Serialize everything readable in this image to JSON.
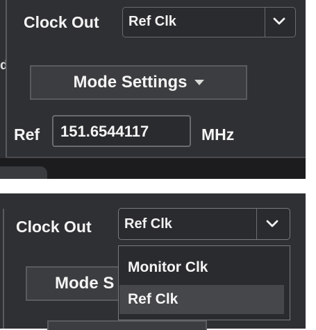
{
  "panel_top": {
    "fragment": "d",
    "clock_out": {
      "label": "Clock Out",
      "selected": "Ref Clk",
      "arrow_icon": "chevron-down-icon"
    },
    "mode_settings": {
      "label": "Mode Settings",
      "arrow_icon": "triangle-down-icon"
    },
    "ref": {
      "label": "Ref",
      "value": "151.6544117",
      "unit": "MHz"
    }
  },
  "panel_bottom": {
    "clock_out": {
      "label": "Clock Out",
      "selected": "Ref Clk",
      "arrow_icon": "chevron-down-icon"
    },
    "mode_button_label": "Mode S",
    "dropdown": {
      "options": [
        "Monitor Clk",
        "Ref Clk"
      ],
      "selected_index": 1
    }
  },
  "colors": {
    "panel_bg": "#2f3033",
    "border": "#6b6c70",
    "text": "#f5f5f5",
    "highlight": "#46474a"
  }
}
